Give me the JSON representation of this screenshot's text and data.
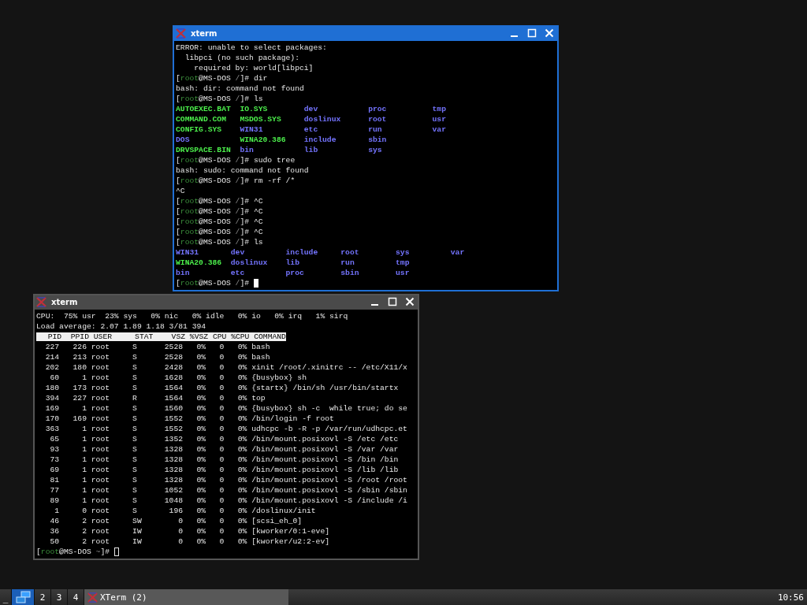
{
  "windows": [
    {
      "title": "xterm",
      "focused": true,
      "lines": [
        {
          "kind": "text",
          "text": "ERROR: unable to select packages:"
        },
        {
          "kind": "text",
          "text": "  libpci (no such package):"
        },
        {
          "kind": "text",
          "text": "    required by: world[libpci]"
        },
        {
          "kind": "prompt",
          "parts": [
            "[",
            "root",
            "@MS-DOS ",
            "/",
            "]# dir"
          ]
        },
        {
          "kind": "text",
          "text": "bash: dir: command not found"
        },
        {
          "kind": "prompt",
          "parts": [
            "[",
            "root",
            "@MS-DOS ",
            "/",
            "]# ls"
          ]
        },
        {
          "kind": "ls",
          "rows": [
            [
              {
                "text": "AUTOEXEC.BAT",
                "color": "#4cf04c"
              },
              {
                "text": "IO.SYS",
                "color": "#4cf04c"
              },
              {
                "text": "dev",
                "color": "#7474ff"
              },
              {
                "text": "proc",
                "color": "#7474ff"
              },
              {
                "text": "tmp",
                "color": "#7474ff"
              }
            ],
            [
              {
                "text": "COMMAND.COM",
                "color": "#4cf04c"
              },
              {
                "text": "MSDOS.SYS",
                "color": "#4cf04c"
              },
              {
                "text": "doslinux",
                "color": "#7474ff"
              },
              {
                "text": "root",
                "color": "#7474ff"
              },
              {
                "text": "usr",
                "color": "#7474ff"
              }
            ],
            [
              {
                "text": "CONFIG.SYS",
                "color": "#4cf04c"
              },
              {
                "text": "WIN31",
                "color": "#7474ff"
              },
              {
                "text": "etc",
                "color": "#7474ff"
              },
              {
                "text": "run",
                "color": "#7474ff"
              },
              {
                "text": "var",
                "color": "#7474ff"
              }
            ],
            [
              {
                "text": "DOS",
                "color": "#7474ff"
              },
              {
                "text": "WINA20.386",
                "color": "#4cf04c"
              },
              {
                "text": "include",
                "color": "#7474ff"
              },
              {
                "text": "sbin",
                "color": "#7474ff"
              }
            ],
            [
              {
                "text": "DRVSPACE.BIN",
                "color": "#4cf04c"
              },
              {
                "text": "bin",
                "color": "#7474ff"
              },
              {
                "text": "lib",
                "color": "#7474ff"
              },
              {
                "text": "sys",
                "color": "#7474ff"
              }
            ]
          ]
        },
        {
          "kind": "prompt",
          "parts": [
            "[",
            "root",
            "@MS-DOS ",
            "/",
            "]# sudo tree"
          ]
        },
        {
          "kind": "text",
          "text": "bash: sudo: command not found"
        },
        {
          "kind": "prompt",
          "parts": [
            "[",
            "root",
            "@MS-DOS ",
            "/",
            "]# rm -rf /*"
          ]
        },
        {
          "kind": "text",
          "text": "^C"
        },
        {
          "kind": "prompt",
          "parts": [
            "[",
            "root",
            "@MS-DOS ",
            "/",
            "]# ^C"
          ]
        },
        {
          "kind": "prompt",
          "parts": [
            "[",
            "root",
            "@MS-DOS ",
            "/",
            "]# ^C"
          ]
        },
        {
          "kind": "prompt",
          "parts": [
            "[",
            "root",
            "@MS-DOS ",
            "/",
            "]# ^C"
          ]
        },
        {
          "kind": "prompt",
          "parts": [
            "[",
            "root",
            "@MS-DOS ",
            "/",
            "]# ^C"
          ]
        },
        {
          "kind": "prompt",
          "parts": [
            "[",
            "root",
            "@MS-DOS ",
            "/",
            "]# ls"
          ]
        },
        {
          "kind": "ls",
          "rows": [
            [
              {
                "text": "WIN31",
                "color": "#7474ff"
              },
              {
                "text": "dev",
                "color": "#7474ff"
              },
              {
                "text": "include",
                "color": "#7474ff"
              },
              {
                "text": "root",
                "color": "#7474ff"
              },
              {
                "text": "sys",
                "color": "#7474ff"
              },
              {
                "text": "var",
                "color": "#7474ff"
              }
            ],
            [
              {
                "text": "WINA20.386",
                "color": "#4cf04c"
              },
              {
                "text": "doslinux",
                "color": "#7474ff"
              },
              {
                "text": "lib",
                "color": "#7474ff"
              },
              {
                "text": "run",
                "color": "#7474ff"
              },
              {
                "text": "tmp",
                "color": "#7474ff"
              }
            ],
            [
              {
                "text": "bin",
                "color": "#7474ff"
              },
              {
                "text": "etc",
                "color": "#7474ff"
              },
              {
                "text": "proc",
                "color": "#7474ff"
              },
              {
                "text": "sbin",
                "color": "#7474ff"
              },
              {
                "text": "usr",
                "color": "#7474ff"
              }
            ]
          ]
        },
        {
          "kind": "prompt",
          "parts": [
            "[",
            "root",
            "@MS-DOS ",
            "/",
            "]# "
          ],
          "cursor": true
        }
      ]
    },
    {
      "title": "xterm",
      "focused": false,
      "lines": [
        {
          "kind": "text",
          "text": "CPU:  75% usr  23% sys   0% nic   0% idle   0% io   0% irq   1% sirq"
        },
        {
          "kind": "text",
          "text": "Load average: 2.07 1.89 1.18 3/81 394"
        },
        {
          "kind": "header",
          "text": "  PID  PPID USER     STAT    VSZ %VSZ CPU %CPU COMMAND"
        },
        {
          "kind": "text",
          "text": "  227   226 root     S      2528   0%   0   0% bash"
        },
        {
          "kind": "text",
          "text": "  214   213 root     S      2528   0%   0   0% bash"
        },
        {
          "kind": "text",
          "text": "  202   180 root     S      2428   0%   0   0% xinit /root/.xinitrc -- /etc/X11/x"
        },
        {
          "kind": "text",
          "text": "   60     1 root     S      1628   0%   0   0% {busybox} sh"
        },
        {
          "kind": "text",
          "text": "  180   173 root     S      1564   0%   0   0% {startx} /bin/sh /usr/bin/startx"
        },
        {
          "kind": "text",
          "text": "  394   227 root     R      1564   0%   0   0% top"
        },
        {
          "kind": "text",
          "text": "  169     1 root     S      1560   0%   0   0% {busybox} sh -c  while true; do se"
        },
        {
          "kind": "text",
          "text": "  170   169 root     S      1552   0%   0   0% /bin/login -f root"
        },
        {
          "kind": "text",
          "text": "  363     1 root     S      1552   0%   0   0% udhcpc -b -R -p /var/run/udhcpc.et"
        },
        {
          "kind": "text",
          "text": "   65     1 root     S      1352   0%   0   0% /bin/mount.posixovl -S /etc /etc"
        },
        {
          "kind": "text",
          "text": "   93     1 root     S      1328   0%   0   0% /bin/mount.posixovl -S /var /var"
        },
        {
          "kind": "text",
          "text": "   73     1 root     S      1328   0%   0   0% /bin/mount.posixovl -S /bin /bin"
        },
        {
          "kind": "text",
          "text": "   69     1 root     S      1328   0%   0   0% /bin/mount.posixovl -S /lib /lib"
        },
        {
          "kind": "text",
          "text": "   81     1 root     S      1328   0%   0   0% /bin/mount.posixovl -S /root /root"
        },
        {
          "kind": "text",
          "text": "   77     1 root     S      1052   0%   0   0% /bin/mount.posixovl -S /sbin /sbin"
        },
        {
          "kind": "text",
          "text": "   89     1 root     S      1048   0%   0   0% /bin/mount.posixovl -S /include /i"
        },
        {
          "kind": "text",
          "text": "    1     0 root     S       196   0%   0   0% /doslinux/init"
        },
        {
          "kind": "text",
          "text": "   46     2 root     SW        0   0%   0   0% [scsi_eh_0]"
        },
        {
          "kind": "text",
          "text": "   36     2 root     IW        0   0%   0   0% [kworker/0:1-eve]"
        },
        {
          "kind": "text",
          "text": "   50     2 root     IW        0   0%   0   0% [kworker/u2:2-ev]"
        },
        {
          "kind": "prompt",
          "parts": [
            "[",
            "root",
            "@MS-DOS ",
            "~",
            "]# "
          ],
          "cursor": true
        }
      ]
    }
  ],
  "taskbar": {
    "show_desktop": "_",
    "workspaces": [
      {
        "selected": true
      },
      {
        "label": "2",
        "selected": false
      },
      {
        "label": "3",
        "selected": false
      },
      {
        "label": "4",
        "selected": false
      }
    ],
    "task": {
      "label": "XTerm (2)"
    },
    "clock": "10:56"
  }
}
